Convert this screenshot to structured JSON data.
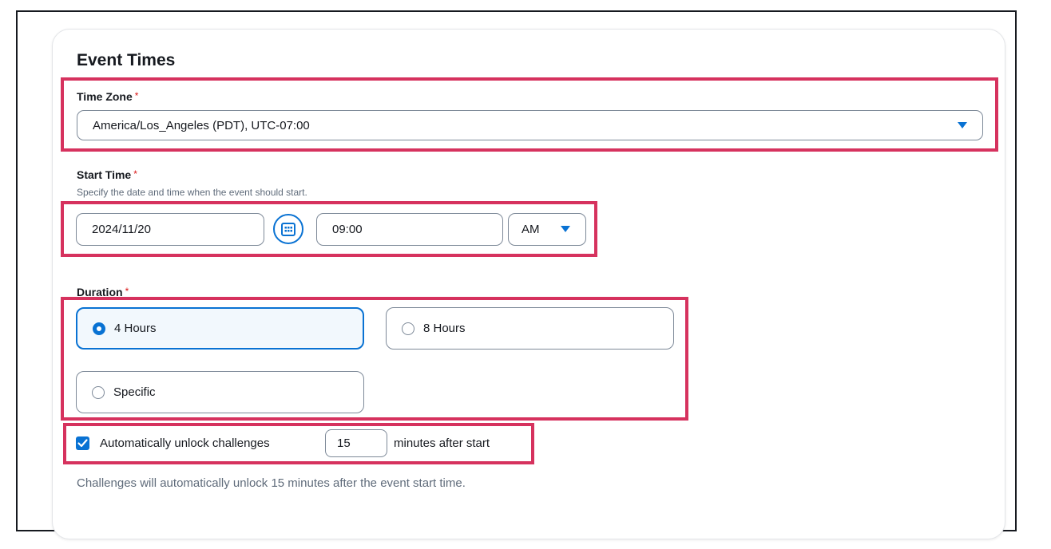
{
  "section": {
    "title": "Event Times"
  },
  "time_zone": {
    "label": "Time Zone",
    "required_mark": "*",
    "value": "America/Los_Angeles (PDT), UTC-07:00"
  },
  "start_time": {
    "label": "Start Time",
    "required_mark": "*",
    "hint": "Specify the date and time when the event should start.",
    "date_value": "2024/11/20",
    "time_value": "09:00",
    "period_value": "AM"
  },
  "duration": {
    "label": "Duration",
    "required_mark": "*",
    "options": [
      {
        "label": "4 Hours",
        "selected": true
      },
      {
        "label": "8 Hours",
        "selected": false
      },
      {
        "label": "Specific",
        "selected": false
      }
    ]
  },
  "auto_unlock": {
    "checked": true,
    "label_before": "Automatically unlock challenges",
    "minutes_value": "15",
    "label_after": "minutes after start",
    "note": "Challenges will automatically unlock 15 minutes after the event start time."
  },
  "colors": {
    "accent": "#0972d3",
    "highlight": "#d6325e",
    "required": "#d91515"
  },
  "icons": {
    "dropdown": "caret-down-icon",
    "calendar": "calendar-icon",
    "checkbox": "checkmark-icon"
  }
}
